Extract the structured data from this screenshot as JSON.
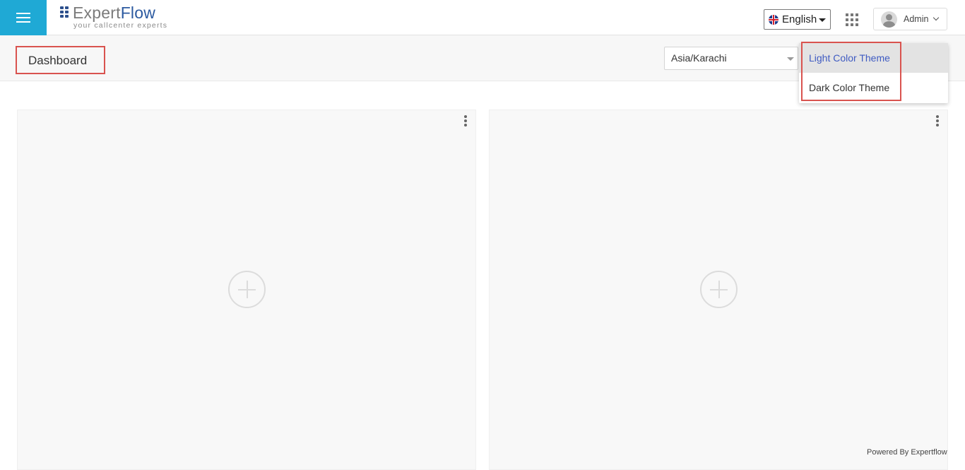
{
  "header": {
    "logo": {
      "brand_part1": "Expert",
      "brand_part2": "Flow",
      "tagline": "your callcenter experts"
    },
    "language": {
      "selected": "English",
      "flag_icon": "uk-flag-icon"
    },
    "user": {
      "name": "Admin"
    }
  },
  "subheader": {
    "page_title": "Dashboard",
    "timezone": {
      "selected": "Asia/Karachi"
    }
  },
  "theme_menu": {
    "items": [
      {
        "label": "Light Color Theme",
        "active": true
      },
      {
        "label": "Dark Color Theme",
        "active": false
      }
    ]
  },
  "footer": {
    "powered_by": "Powered By Expertflow"
  },
  "colors": {
    "accent": "#1fa9d5",
    "highlight_box": "#d9534f",
    "active_menu_text": "#3f5bc2"
  }
}
